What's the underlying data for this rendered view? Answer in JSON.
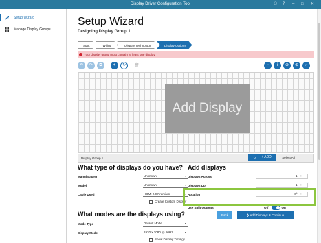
{
  "window": {
    "title": "Display Driver Configuration Tool"
  },
  "sidebar": {
    "items": [
      {
        "label": "Setup Wizard"
      },
      {
        "label": "Manage Display Groups"
      }
    ]
  },
  "header": {
    "title": "Setup Wizard",
    "subtitle": "Designing Display Group 1"
  },
  "breadcrumb": [
    "Start",
    "Wiring",
    "Display Technology",
    "Display Options"
  ],
  "alert": {
    "text": "Your display group must contain at least one display"
  },
  "canvas": {
    "placeholder": "Add Display",
    "group_name": "Display Group 1",
    "unlock_label": "Unlock View",
    "select_all_label": "Select All"
  },
  "display_type": {
    "heading": "What type of displays do you have?",
    "manufacturer_label": "Manufacturer",
    "manufacturer_value": "Unknown",
    "model_label": "Model",
    "model_value": "Unknown",
    "cable_label": "Cable Used",
    "cable_value": "HDMI 2.0 Premium",
    "custom_label": "Create Custom Display"
  },
  "modes": {
    "heading": "What modes are the displays using?",
    "mode_type_label": "Mode Type",
    "mode_type_value": "Default Mode",
    "display_mode_label": "Display Mode",
    "display_mode_value": "1920 x 1080 @ 60Hz",
    "timings_label": "Show Display Timings"
  },
  "add_displays": {
    "heading": "Add displays",
    "add_button": "ADD",
    "across_label": "Displays Across",
    "across_value": "1",
    "up_label": "Displays Up",
    "up_value": "1",
    "rotation_label": "Rotation",
    "rotation_value": "0°",
    "split_label": "Use Split Outputs",
    "split_off": "Off",
    "split_on": "On"
  },
  "footer": {
    "back_label": "Back",
    "continue_label": "Add Displays & Continue"
  },
  "colors": {
    "accent": "#1d6fb0",
    "titlebar": "#2a7a9e",
    "highlight": "#8cc63f",
    "alert_bg": "#f7c9cc"
  }
}
